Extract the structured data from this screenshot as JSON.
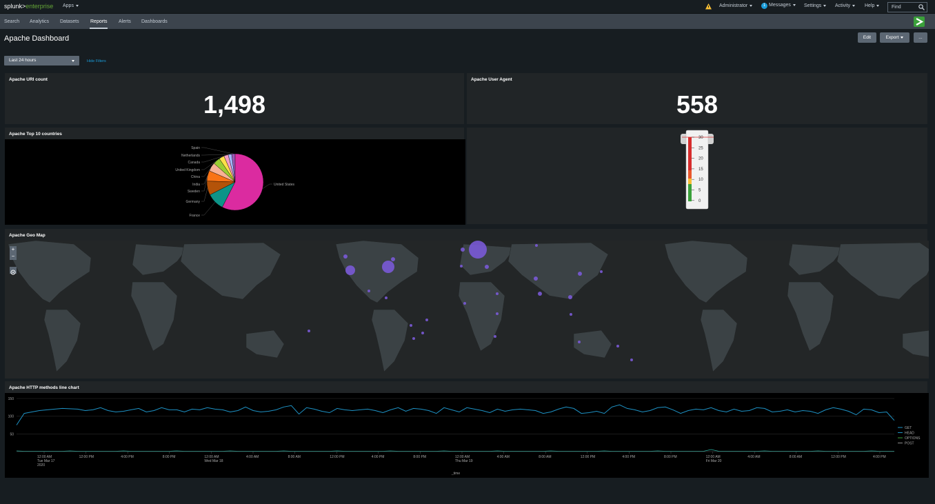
{
  "header": {
    "logo_main": "splunk>",
    "logo_sub": "enterprise",
    "apps": "Apps",
    "administrator": "Administrator",
    "messages_count": "1",
    "messages": "Messages",
    "settings": "Settings",
    "activity": "Activity",
    "help": "Help",
    "find_placeholder": "Find"
  },
  "nav": [
    "Search",
    "Analytics",
    "Datasets",
    "Reports",
    "Alerts",
    "Dashboards"
  ],
  "dashboard": {
    "title": "Apache Dashboard",
    "edit": "Edit",
    "export": "Export",
    "more": "...",
    "time_range": "Last 24 hours",
    "hide_filters": "Hide Filters"
  },
  "panels": {
    "uri_title": "Apache URI count",
    "uri_value": "1,498",
    "ua_title": "Apache User Agent",
    "ua_value": "558",
    "countries_title": "Apache Top 10 countries",
    "geomap_title": "Apache Geo Map",
    "line_title": "Apache HTTP methods line chart"
  },
  "pie": {
    "labels": [
      "Spain",
      "Netherlands",
      "Canada",
      "United Kingdom",
      "China",
      "India",
      "Sweden",
      "Germany",
      "France",
      "United States"
    ],
    "colors": [
      "#9b59b6",
      "#a5b4fc",
      "#f59ec4",
      "#fde047",
      "#9acd32",
      "#f8b195",
      "#f97316",
      "#b45309",
      "#0d9488",
      "#db2ba0"
    ],
    "values": [
      2,
      2,
      2.5,
      3,
      4,
      5,
      6,
      8,
      10,
      57.5
    ]
  },
  "gauge": {
    "ticks": [
      "30",
      "25",
      "20",
      "15",
      "10",
      "5",
      "0"
    ],
    "value": 30
  },
  "line_chart": {
    "y_ticks": [
      "150",
      "100",
      "50"
    ],
    "x_ticks": [
      [
        "12:00 AM",
        "Tue Mar 17",
        "2020"
      ],
      [
        "12:00 PM"
      ],
      [
        "4:00 PM"
      ],
      [
        "8:00 PM"
      ],
      [
        "12:00 AM",
        "Wed Mar 18"
      ],
      [
        "4:00 AM"
      ],
      [
        "8:00 AM"
      ],
      [
        "12:00 PM"
      ],
      [
        "4:00 PM"
      ],
      [
        "8:00 PM"
      ],
      [
        "12:00 AM",
        "Thu Mar 19"
      ],
      [
        "4:00 AM"
      ],
      [
        "8:00 AM"
      ],
      [
        "12:00 PM"
      ],
      [
        "4:00 PM"
      ],
      [
        "8:00 PM"
      ],
      [
        "12:00 AM",
        "Fri Mar 20"
      ],
      [
        "4:00 AM"
      ],
      [
        "8:00 AM"
      ],
      [
        "12:00 PM"
      ],
      [
        "4:00 PM"
      ]
    ],
    "xlabel": "_time",
    "legend": [
      "GET",
      "HEAD",
      "OPTIONS",
      "POST"
    ],
    "colors": [
      "#1e93c6",
      "#1e93c6",
      "#3aa03a",
      "#8d8d8d"
    ],
    "get_values": [
      75,
      108,
      112,
      116,
      118,
      120,
      122,
      121,
      120,
      116,
      118,
      124,
      116,
      112,
      114,
      118,
      122,
      112,
      116,
      124,
      118,
      118,
      112,
      120,
      118,
      124,
      120,
      118,
      112,
      116,
      126,
      116,
      112,
      114,
      118,
      126,
      130,
      106,
      124,
      120,
      114,
      110,
      122,
      118,
      116,
      118,
      120,
      116,
      110,
      118,
      124,
      114,
      122,
      120,
      116,
      108,
      124,
      118,
      112,
      124,
      120,
      116,
      110,
      120,
      114,
      118,
      120,
      118,
      116,
      108,
      112,
      120,
      126,
      122,
      108,
      110,
      114,
      108,
      126,
      132,
      122,
      118,
      112,
      116,
      124,
      126,
      118,
      108,
      116,
      120,
      118,
      124,
      116,
      112,
      120,
      114,
      116,
      124,
      122,
      112,
      114,
      118,
      112,
      116,
      114,
      108,
      118,
      124,
      120,
      114,
      104,
      120,
      118,
      110,
      112,
      88
    ]
  }
}
